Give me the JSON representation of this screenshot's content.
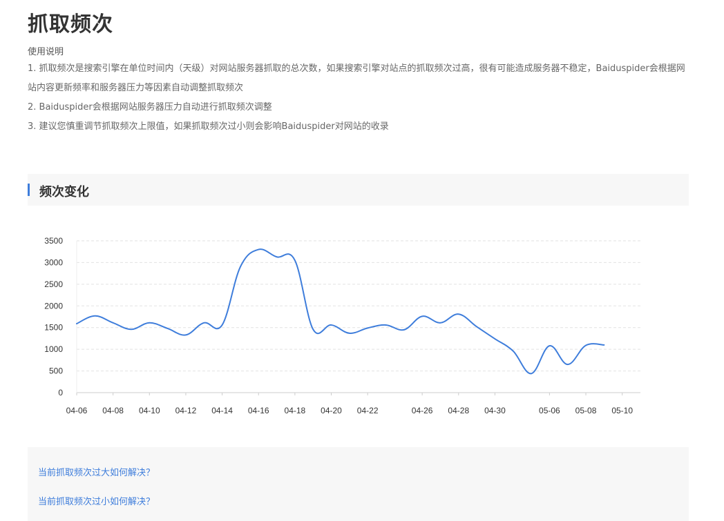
{
  "page": {
    "title": "抓取频次"
  },
  "usage": {
    "heading": "使用说明",
    "items": [
      "1. 抓取频次是搜索引擎在单位时间内（天级）对网站服务器抓取的总次数，如果搜索引擎对站点的抓取频次过高，很有可能造成服务器不稳定，Baiduspider会根据网站内容更新频率和服务器压力等因素自动调整抓取频次",
      "2. Baiduspider会根据网站服务器压力自动进行抓取频次调整",
      "3. 建议您慎重调节抓取频次上限值，如果抓取频次过小则会影响Baiduspider对网站的收录"
    ]
  },
  "section": {
    "title": "频次变化"
  },
  "chart_data": {
    "type": "line",
    "title": "",
    "xlabel": "",
    "ylabel": "",
    "ylim": [
      0,
      3500
    ],
    "yticks": [
      0,
      500,
      1000,
      1500,
      2000,
      2500,
      3000,
      3500
    ],
    "grid": true,
    "line_color": "#3e7ddb",
    "xtick_labels": [
      "04-06",
      "04-08",
      "04-10",
      "04-12",
      "04-14",
      "04-16",
      "04-18",
      "04-20",
      "04-22",
      "04-26",
      "04-28",
      "04-30",
      "05-06",
      "05-08",
      "05-10"
    ],
    "x": [
      "04-06",
      "04-07",
      "04-08",
      "04-09",
      "04-10",
      "04-11",
      "04-12",
      "04-13",
      "04-14",
      "04-15",
      "04-16",
      "04-17",
      "04-18",
      "04-19",
      "04-20",
      "04-21",
      "04-22",
      "04-23",
      "04-24",
      "04-26",
      "04-27",
      "04-28",
      "04-29",
      "04-30",
      "05-01",
      "05-02",
      "05-06",
      "05-07",
      "05-08",
      "05-09",
      "05-10",
      "05-11"
    ],
    "series": [
      {
        "values": [
          1590,
          1770,
          1610,
          1460,
          1610,
          1480,
          1330,
          1610,
          1560,
          2900,
          3300,
          3130,
          3050,
          1460,
          1560,
          1370,
          1490,
          1560,
          1450,
          1760,
          1610,
          1810,
          1520,
          1240,
          960,
          440,
          1080,
          650,
          1090,
          1100
        ]
      }
    ]
  },
  "faq": {
    "link1": "当前抓取频次过大如何解决？",
    "link2": "当前抓取频次过小如何解决？"
  }
}
